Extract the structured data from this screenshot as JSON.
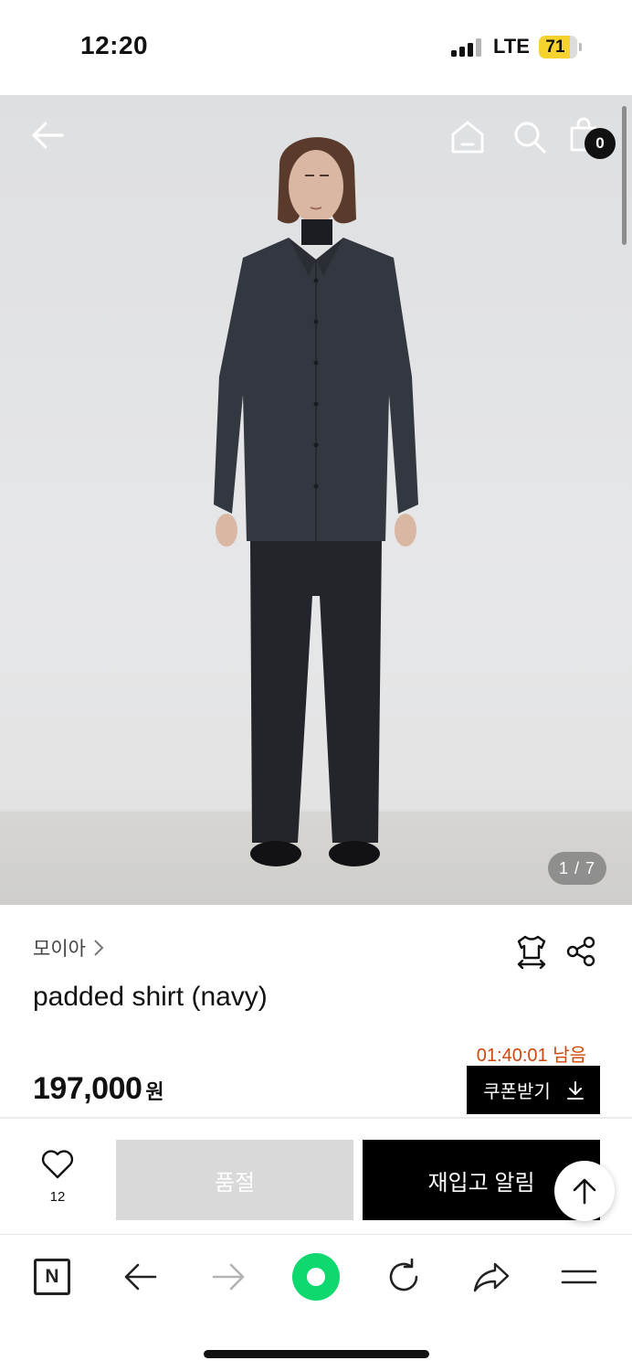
{
  "status_bar": {
    "time": "12:20",
    "network": "LTE",
    "battery": "71"
  },
  "image_header": {
    "cart_count": "0",
    "image_counter": "1 / 7"
  },
  "product": {
    "brand": "모이아",
    "title": "padded shirt (navy)",
    "timer": "01:40:01 남음",
    "price": "197,000",
    "price_unit": "원",
    "coupon_label": "쿠폰받기"
  },
  "actions": {
    "like_count": "12",
    "soldout_label": "품절",
    "restock_label": "재입고 알림"
  },
  "browser_toolbar": {
    "naver_label": "N"
  },
  "colors": {
    "accent_timer": "#d1460b",
    "primary_button": "#000000",
    "disabled_button": "#d9d9d9",
    "battery": "#f6d22f",
    "browser_home": "#0fd86e"
  }
}
